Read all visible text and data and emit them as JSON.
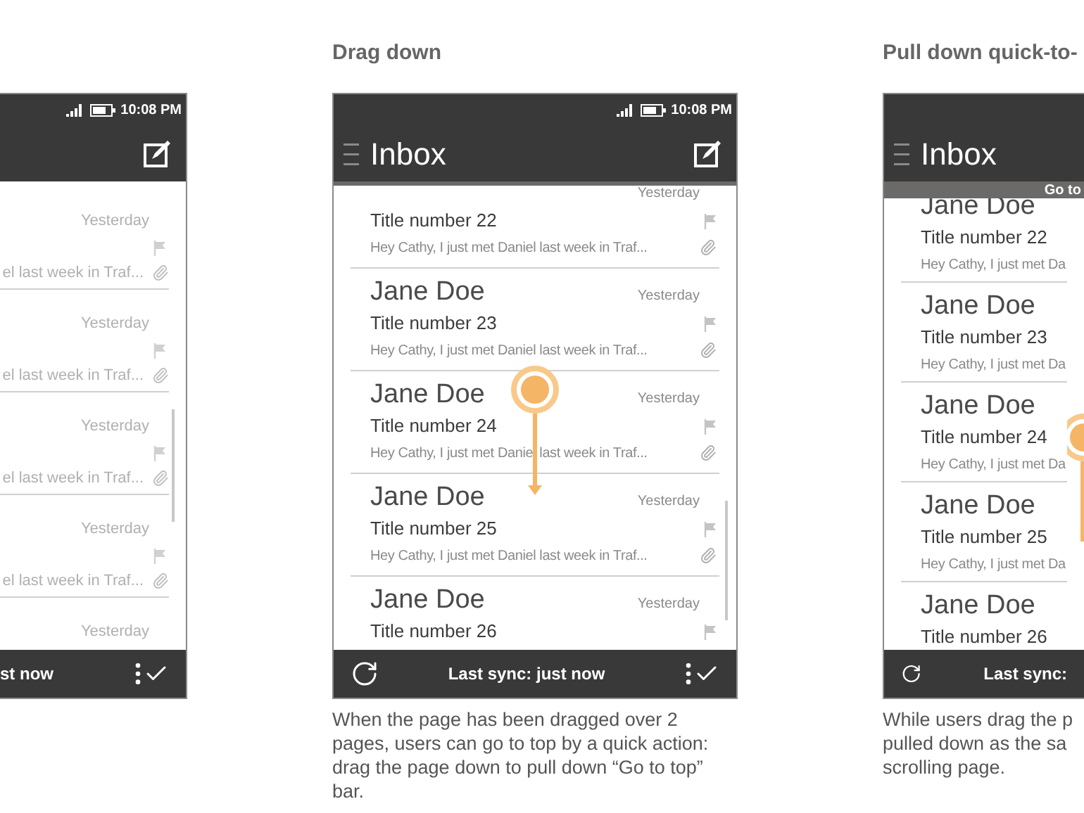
{
  "screens": [
    {
      "kind": "partial-left",
      "status_time": "10:08 PM",
      "emails": [
        {
          "date": "Yesterday",
          "preview": "el last week in Traf..."
        },
        {
          "date": "Yesterday",
          "preview": "el last week in Traf..."
        },
        {
          "date": "Yesterday",
          "preview": "el last week in Traf..."
        },
        {
          "date": "Yesterday",
          "preview": "el last week in Traf..."
        },
        {
          "date": "Yesterday"
        }
      ],
      "sync_text": "st now"
    },
    {
      "kind": "full",
      "heading": "Drag down",
      "status_time": "10:08 PM",
      "title": "Inbox",
      "emails": [
        {
          "date": "Yesterday",
          "subject": "Title number 22",
          "preview": "Hey Cathy, I just met Daniel last week in Traf..."
        },
        {
          "sender": "Jane Doe",
          "date": "Yesterday",
          "subject": "Title number 23",
          "preview": "Hey Cathy, I just met Daniel last week in Traf..."
        },
        {
          "sender": "Jane Doe",
          "date": "Yesterday",
          "subject": "Title number 24",
          "preview": "Hey Cathy, I just met Daniel last week in Traf..."
        },
        {
          "sender": "Jane Doe",
          "date": "Yesterday",
          "subject": "Title number 25",
          "preview": "Hey Cathy, I just met Daniel last week in Traf..."
        },
        {
          "sender": "Jane Doe",
          "date": "Yesterday",
          "subject": "Title number 26"
        }
      ],
      "sync_text": "Last sync: just now",
      "caption": "When the page has been dragged over 2 pages, users can go to top by a quick action: drag the page down to pull down “Go to top” bar."
    },
    {
      "kind": "partial-right",
      "heading": "Pull down quick-to-",
      "title": "Inbox",
      "go_to_top": "Go to",
      "emails": [
        {
          "sender": "Jane Doe",
          "subject": "Title number 22",
          "preview": "Hey Cathy, I just met Da"
        },
        {
          "sender": "Jane Doe",
          "subject": "Title number 23",
          "preview": "Hey Cathy, I just met Da"
        },
        {
          "sender": "Jane Doe",
          "subject": "Title number 24",
          "preview": "Hey Cathy, I just met Da"
        },
        {
          "sender": "Jane Doe",
          "subject": "Title number 25",
          "preview": "Hey Cathy, I just met Da"
        },
        {
          "sender": "Jane Doe",
          "subject": "Title number 26"
        }
      ],
      "sync_text": "Last sync:",
      "caption_lines": [
        "While users drag the p",
        "pulled down as the sa",
        "scrolling page."
      ]
    }
  ]
}
